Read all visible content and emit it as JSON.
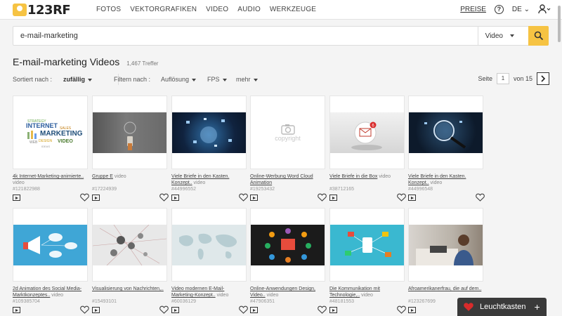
{
  "header": {
    "logo_text": "123RF",
    "nav": [
      "FOTOS",
      "VEKTORGRAFIKEN",
      "VIDEO",
      "AUDIO",
      "WERKZEUGE"
    ],
    "preise": "PREISE",
    "help": "?",
    "lang": "DE"
  },
  "search": {
    "value": "e-mail-marketing",
    "type": "Video"
  },
  "results": {
    "title": "E-mail-marketing Videos",
    "count": "1,467 Treffer"
  },
  "filters": {
    "sort_label": "Sortiert nach :",
    "sort_value": "zufällig",
    "filter_label": "Filtern nach :",
    "resolution": "Auflösung",
    "fps": "FPS",
    "more": "mehr",
    "page_label": "Seite",
    "page_value": "1",
    "page_of": "von 15"
  },
  "cards": [
    {
      "title": "4k Internet-Marketing-animierte..",
      "type": "video",
      "id": "#121822988"
    },
    {
      "title": "Gruppe E",
      "type": "video",
      "id": "#17224939"
    },
    {
      "title": "Viele Briefe in den Kasten. Konzept..",
      "type": "video",
      "id": "#44996552"
    },
    {
      "title": "Online-Werbung Word Cloud Animation",
      "type": "",
      "id": "#19253432"
    },
    {
      "title": "Viele Briefe in die Box",
      "type": "video",
      "id": "#38712165"
    },
    {
      "title": "Viele Briefe in den Kasten. Konzept..",
      "type": "video",
      "id": "#44996548"
    },
    {
      "title": "2d Animation des Social Media-Marktkonzeptes..",
      "type": "video",
      "id": "#109385704"
    },
    {
      "title": "Visualisierung von Nachrichten,..",
      "type": "",
      "id": "#15493101"
    },
    {
      "title": "Video modernen E-Mail-Marketing-Konzept..",
      "type": "video",
      "id": "#60036129"
    },
    {
      "title": "Online-Anwendungen Design, Video..",
      "type": "video",
      "id": "#47906351"
    },
    {
      "title": "Die Kommunikation mit Technologie,..",
      "type": "video",
      "id": "#48181553"
    },
    {
      "title": "Afroamerikanerfrau, die auf dem..",
      "type": "",
      "id": "#123267699"
    }
  ],
  "thumb_placeholder": "copyright",
  "wordcloud": [
    "INTERNET",
    "MARKETING",
    "VIDEO",
    "STRATEGY",
    "SALES",
    "DESIGN",
    "WEB",
    "IDEAS"
  ],
  "lightbox": {
    "label": "Leuchtkasten",
    "plus": "+"
  },
  "colors": {
    "accent": "#f6c343",
    "lightbox_bg": "#3a3a3a",
    "heart_red": "#d92b2b"
  }
}
